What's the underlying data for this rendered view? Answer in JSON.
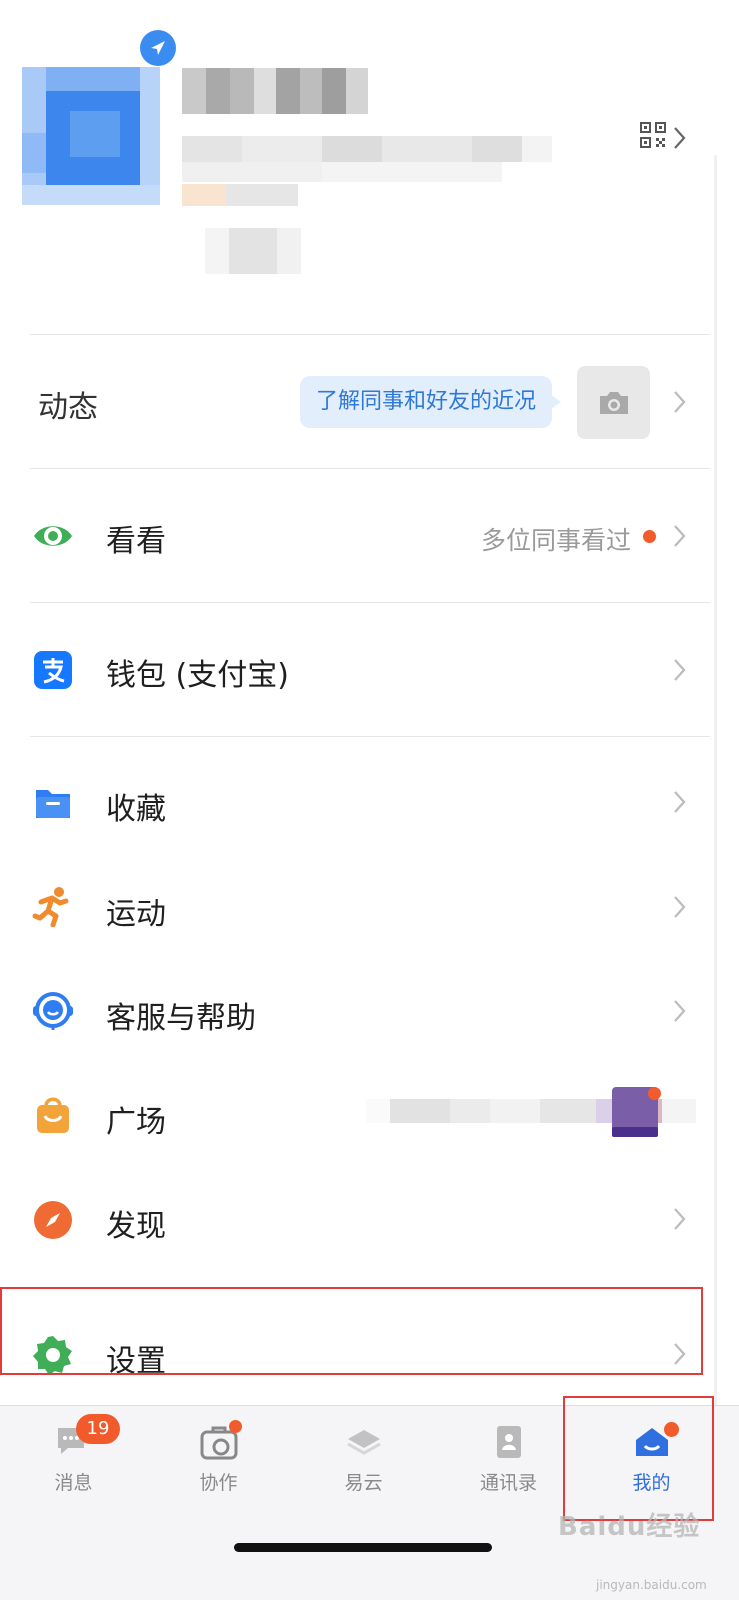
{
  "feed": {
    "label": "动态",
    "bubble": "了解同事和好友的近况"
  },
  "menu": {
    "kankan": {
      "label": "看看",
      "hint": "多位同事看过"
    },
    "wallet": {
      "label": "钱包 (支付宝)"
    },
    "favorites": {
      "label": "收藏"
    },
    "sports": {
      "label": "运动"
    },
    "service": {
      "label": "客服与帮助"
    },
    "plaza": {
      "label": "广场"
    },
    "discover": {
      "label": "发现"
    },
    "settings": {
      "label": "设置"
    }
  },
  "tabs": [
    {
      "label": "消息",
      "badge": "19"
    },
    {
      "label": "协作"
    },
    {
      "label": "易云"
    },
    {
      "label": "通讯录"
    },
    {
      "label": "我的",
      "active": true
    }
  ],
  "watermark": {
    "brand": "Baidu经验",
    "url": "jingyan.baidu.com"
  },
  "colors": {
    "accent": "#3b8cf0",
    "badge": "#f35a2b",
    "highlight_border": "#e23b3b",
    "active_tab": "#2f6fe0"
  },
  "icons": {
    "kankan": "eye-icon",
    "wallet": "alipay-icon",
    "favorites": "folder-icon",
    "sports": "running-person-icon",
    "service": "headset-icon",
    "plaza": "shopping-bag-icon",
    "discover": "compass-icon",
    "settings": "gear-icon"
  }
}
